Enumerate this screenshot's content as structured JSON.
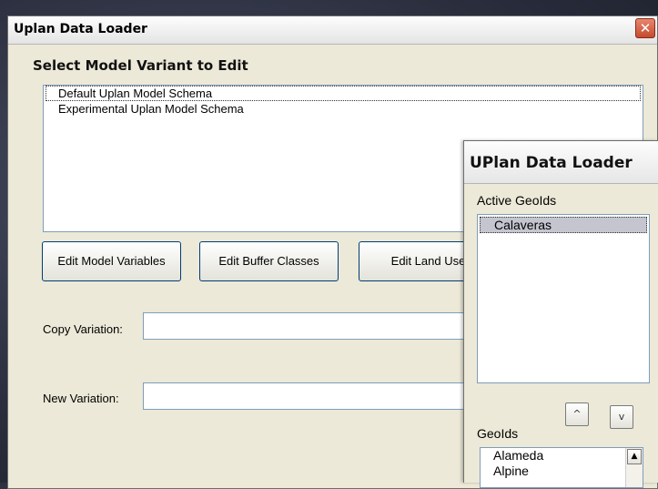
{
  "window": {
    "title": "Uplan Data Loader",
    "close_glyph": "✕"
  },
  "variant_section": {
    "title": "Select Model Variant to Edit",
    "items": [
      {
        "label": "Default Uplan Model Schema",
        "selected": true
      },
      {
        "label": "Experimental Uplan Model Schema",
        "selected": false
      }
    ]
  },
  "buttons": {
    "edit_model_variables": "Edit Model Variables",
    "edit_buffer_classes": "Edit Buffer Classes",
    "edit_land_use": "Edit Land Use"
  },
  "fields": {
    "copy_variation_label": "Copy Variation:",
    "copy_variation_value": "",
    "new_variation_label": "New Variation:",
    "new_variation_value": ""
  },
  "popup": {
    "title": "UPlan Data Loader",
    "active_geoids_label": "Active GeoIds",
    "active_geoids": [
      "Calaveras"
    ],
    "up_glyph": "^",
    "down_glyph": "v",
    "geoids_label": "GeoIds",
    "geoids": [
      "Alameda",
      "Alpine"
    ],
    "scroll_up_glyph": "▲"
  }
}
